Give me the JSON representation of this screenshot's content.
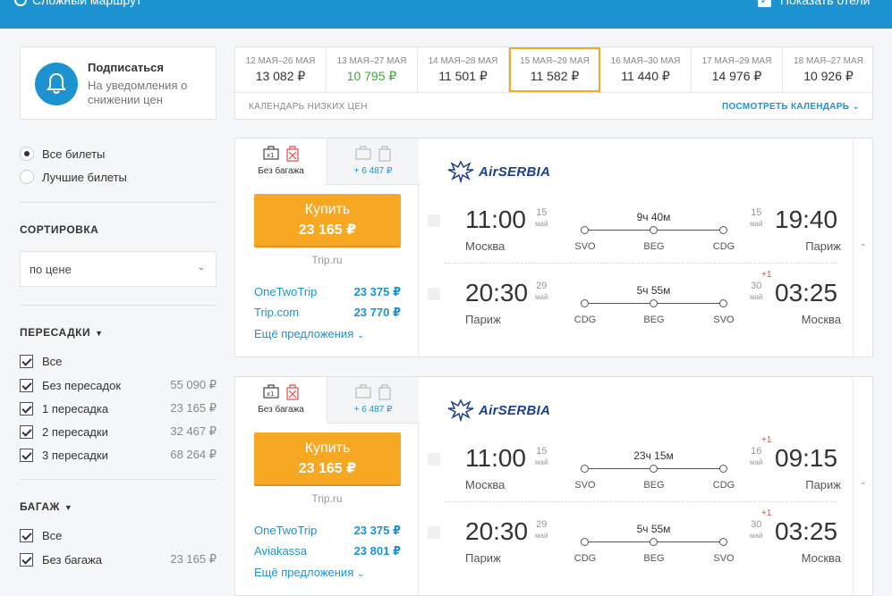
{
  "topbar": {
    "route_label": "Сложный маршрут",
    "hotels_label": "Показать отели"
  },
  "subscribe": {
    "title": "Подписаться",
    "subtitle": "На уведомления о снижении цен"
  },
  "filters": {
    "ticket_options": [
      {
        "label": "Все билеты",
        "selected": true
      },
      {
        "label": "Лучшие билеты",
        "selected": false
      }
    ],
    "sort_title": "СОРТИРОВКА",
    "sort_value": "по цене",
    "stops_title": "ПЕРЕСАДКИ",
    "stops": [
      {
        "label": "Все",
        "price": ""
      },
      {
        "label": "Без пересадок",
        "price": "55 090 ₽"
      },
      {
        "label": "1 пересадка",
        "price": "23 165 ₽"
      },
      {
        "label": "2 пересадки",
        "price": "32 467 ₽"
      },
      {
        "label": "3 пересадки",
        "price": "68 264 ₽"
      }
    ],
    "baggage_title": "БАГАЖ",
    "baggage": [
      {
        "label": "Все",
        "price": ""
      },
      {
        "label": "Без багажа",
        "price": "23 165 ₽"
      }
    ]
  },
  "calendar": {
    "cells": [
      {
        "dates": "12 МАЯ–26 МАЯ",
        "price": "13 082 ₽"
      },
      {
        "dates": "13 МАЯ–27 МАЯ",
        "price": "10 795 ₽"
      },
      {
        "dates": "14 МАЯ–28 МАЯ",
        "price": "11 501 ₽"
      },
      {
        "dates": "15 МАЯ–29 МАЯ",
        "price": "11 582 ₽"
      },
      {
        "dates": "16 МАЯ–30 МАЯ",
        "price": "11 440 ₽"
      },
      {
        "dates": "17 МАЯ–29 МАЯ",
        "price": "14 976 ₽"
      },
      {
        "dates": "18 МАЯ–27 МАЯ",
        "price": "10 926 ₽"
      }
    ],
    "footer_left": "КАЛЕНДАРЬ НИЗКИХ ЦЕН",
    "footer_right": "ПОСМОТРЕТЬ КАЛЕНДАРЬ"
  },
  "tickets": [
    {
      "baggage_tab_1": "Без багажа",
      "baggage_tab_2": "+ 6 487 ₽",
      "buy_label": "Купить",
      "buy_price": "23 165 ₽",
      "agency": "Trip.ru",
      "offers": [
        {
          "name": "OneTwoTrip",
          "price": "23 375 ₽"
        },
        {
          "name": "Trip.com",
          "price": "23 770 ₽"
        }
      ],
      "more": "Ещё предложения",
      "airline": "AirSERBIA",
      "segments": [
        {
          "dep_time": "11:00",
          "dep_day": "15",
          "dep_mon": "май",
          "dep_city": "Москва",
          "duration": "9ч 40м",
          "codes": [
            "SVO",
            "BEG",
            "CDG"
          ],
          "arr_day": "15",
          "arr_mon": "май",
          "arr_plus": "",
          "arr_time": "19:40",
          "arr_city": "Париж"
        },
        {
          "dep_time": "20:30",
          "dep_day": "29",
          "dep_mon": "май",
          "dep_city": "Париж",
          "duration": "5ч 55м",
          "codes": [
            "CDG",
            "BEG",
            "SVO"
          ],
          "arr_day": "30",
          "arr_mon": "май",
          "arr_plus": "+1",
          "arr_time": "03:25",
          "arr_city": "Москва"
        }
      ]
    },
    {
      "baggage_tab_1": "Без багажа",
      "baggage_tab_2": "+ 6 487 ₽",
      "buy_label": "Купить",
      "buy_price": "23 165 ₽",
      "agency": "Trip.ru",
      "offers": [
        {
          "name": "OneTwoTrip",
          "price": "23 375 ₽"
        },
        {
          "name": "Aviakassa",
          "price": "23 801 ₽"
        }
      ],
      "more": "Ещё предложения",
      "airline": "AirSERBIA",
      "segments": [
        {
          "dep_time": "11:00",
          "dep_day": "15",
          "dep_mon": "май",
          "dep_city": "Москва",
          "duration": "23ч 15м",
          "codes": [
            "SVO",
            "BEG",
            "CDG"
          ],
          "arr_day": "16",
          "arr_mon": "май",
          "arr_plus": "+1",
          "arr_time": "09:15",
          "arr_city": "Париж"
        },
        {
          "dep_time": "20:30",
          "dep_day": "29",
          "dep_mon": "май",
          "dep_city": "Париж",
          "duration": "5ч 55м",
          "codes": [
            "CDG",
            "BEG",
            "SVO"
          ],
          "arr_day": "30",
          "arr_mon": "май",
          "arr_plus": "+1",
          "arr_time": "03:25",
          "arr_city": "Москва"
        }
      ]
    }
  ],
  "colors": {
    "brand_blue": "#1d93d1",
    "buy_orange": "#f7a823",
    "price_green": "#3aa936",
    "airline_navy": "#1b3f8f"
  }
}
